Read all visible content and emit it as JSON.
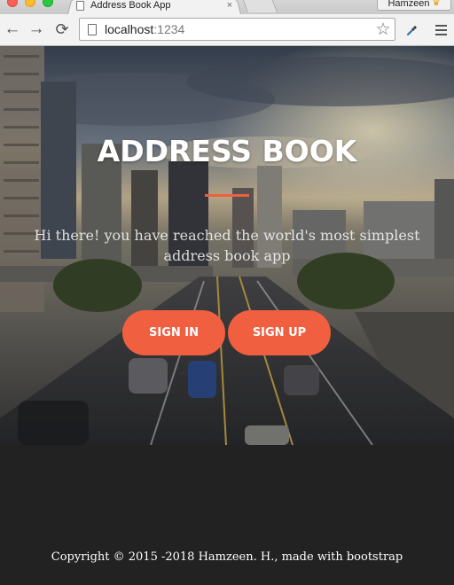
{
  "browser": {
    "tab_title": "Address Book App",
    "tab_close": "×",
    "profile_name": "Hamzeen",
    "profile_icon": "crown-icon",
    "url_host": "localhost",
    "url_port": ":1234",
    "nav_back": "←",
    "nav_forward": "→",
    "nav_reload": "⟳",
    "bookmark_star": "☆"
  },
  "hero": {
    "title": "ADDRESS BOOK",
    "lead": "Hi there! you have reached the world's most simplest address book app",
    "accent_color": "#f05f40"
  },
  "actions": {
    "sign_in": "SIGN IN",
    "sign_up": "SIGN UP"
  },
  "footer": {
    "copyright": "Copyright © 2015 -2018 Hamzeen. H., made with bootstrap"
  }
}
